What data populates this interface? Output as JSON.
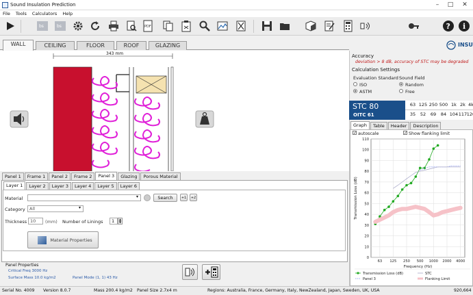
{
  "window": {
    "title": "Sound Insulation Prediction",
    "minimize": "–",
    "maximize": "□",
    "close": "✕"
  },
  "menu": [
    "File",
    "Tools",
    "Calculators",
    "Help"
  ],
  "toolbar": [
    {
      "name": "run-icon"
    },
    {
      "name": "bs-icon"
    },
    {
      "name": "bs-icon-2"
    },
    {
      "name": "gear-icon"
    },
    {
      "name": "refresh-icon"
    },
    {
      "name": "print-icon"
    },
    {
      "name": "print-preview-icon"
    },
    {
      "name": "pdf-icon"
    },
    {
      "name": "copy-icon"
    },
    {
      "name": "clipboard-icon"
    },
    {
      "name": "search-icon"
    },
    {
      "name": "image-icon"
    },
    {
      "name": "cross-box-icon"
    },
    {
      "name": "save-icon"
    },
    {
      "name": "open-icon"
    },
    {
      "name": "cube-icon"
    },
    {
      "name": "edit-note-icon"
    },
    {
      "name": "calculator-icon"
    },
    {
      "name": "speaker-icon"
    },
    {
      "name": "key-icon"
    },
    {
      "name": "help-icon"
    },
    {
      "name": "info-icon"
    }
  ],
  "tabs": [
    "WALL",
    "CEILING",
    "FLOOR",
    "ROOF",
    "GLAZING"
  ],
  "logo": "INSUL",
  "drawing": {
    "dimension": "343 mm"
  },
  "panel_tabs": [
    "Panel 1",
    "Frame 1",
    "Panel 2",
    "Frame 2",
    "Panel 3",
    "Glazing",
    "Porous Material"
  ],
  "layer_tabs": [
    "Layer 1",
    "Layer 2",
    "Layer 3",
    "Layer 4",
    "Layer 5",
    "Layer 6"
  ],
  "layer": {
    "material_label": "Material",
    "material_value": "",
    "search_label": "Search",
    "btn_a": "+1",
    "btn_b": "+2",
    "category_label": "Category",
    "category_value": "All",
    "thickness_label": "Thickness",
    "thickness_value": "10",
    "thickness_unit": "(mm)",
    "linings_label": "Number of Linings",
    "linings_value": "1",
    "props_button": "Material Properties"
  },
  "panel_properties": {
    "heading": "Panel Properties",
    "critical": "Critical Freq 3000 Hz",
    "surface": "Surface Mass 10.0 kg/m2",
    "mode": "Panel Mode (1, 1) 43 Hz"
  },
  "status": {
    "serial": "Serial No. 4009",
    "version": "Version  8.0.7",
    "mass": "Mass 200.4 kg/m2",
    "size": "Panel Size 2.7x4 m",
    "regions": "Regions: Australia, France, Germany, Italy, NewZealand, Japan, Sweden, UK, USA",
    "coords": "920,664"
  },
  "accuracy": {
    "heading": "Accuracy",
    "note": "deviation > 8 dB, accuracy of STC may be degraded"
  },
  "calc": {
    "heading": "Calculation Settings",
    "std_label": "Evaluation Standard",
    "std_iso": "ISO",
    "std_astm": "ASTM",
    "field_label": "Sound Field",
    "field_random": "Random",
    "field_free": "Free"
  },
  "rating": {
    "stc": "STC 80",
    "oitc": "OITC 61"
  },
  "bands": {
    "freq": [
      "63",
      "125",
      "250",
      "500",
      "1k",
      "2k",
      "4k"
    ],
    "tl": [
      "35",
      "52",
      "69",
      "84",
      "104",
      "117",
      "120"
    ]
  },
  "graph_tabs": [
    "Graph",
    "Table",
    "Header",
    "Description"
  ],
  "graph_opts": {
    "autoscale": "autoscale",
    "flanking": "Show flanking limit"
  },
  "chart_data": {
    "type": "line",
    "xlabel": "Frequency (Hz)",
    "ylabel": "Transmission Loss (dB)",
    "x_ticks": [
      "63",
      "125",
      "250",
      "500",
      "1000",
      "2000",
      "4000"
    ],
    "ylim": [
      0,
      110
    ],
    "y_ticks": [
      0,
      10,
      20,
      30,
      40,
      50,
      60,
      70,
      80,
      90,
      100,
      110
    ],
    "series": [
      {
        "name": "Transmission Loss (dB)",
        "color": "#22aa22",
        "marker": true,
        "x": [
          50,
          63,
          80,
          100,
          125,
          160,
          200,
          250,
          315,
          400,
          500,
          630,
          800,
          1000,
          1250
        ],
        "y": [
          31,
          38,
          44,
          47,
          52,
          57,
          63,
          67,
          69,
          75,
          83,
          83,
          91,
          101,
          104
        ]
      },
      {
        "name": "Panel 3",
        "color": "#7788ee",
        "dash": true,
        "x": [
          500,
          630,
          800,
          1000,
          1250,
          1600,
          2000,
          2500,
          3150,
          4000
        ],
        "y": [
          81,
          83,
          84,
          84,
          84,
          84,
          84,
          85,
          85,
          85
        ]
      },
      {
        "name": "STC",
        "color": "#a6a6c8",
        "x": [
          125,
          160,
          200,
          250,
          315,
          400,
          500,
          630,
          800,
          1000,
          1250,
          1600,
          2000,
          2500,
          3150,
          4000
        ],
        "y": [
          64,
          67,
          70,
          73,
          76,
          79,
          80,
          81,
          82,
          83,
          84,
          84,
          84,
          84,
          84,
          84
        ]
      },
      {
        "name": "Flanking Limit",
        "color": "#f6c2c8",
        "band": true,
        "x": [
          50,
          63,
          80,
          100,
          125,
          160,
          200,
          250,
          315,
          400,
          500,
          630,
          800,
          1000,
          1250,
          1600,
          2000,
          2500,
          3150,
          4000
        ],
        "y": [
          33,
          35,
          37,
          39,
          42,
          44,
          45,
          45,
          46,
          47,
          46,
          45,
          42,
          39,
          40,
          42,
          43,
          44,
          45,
          46
        ]
      }
    ]
  }
}
